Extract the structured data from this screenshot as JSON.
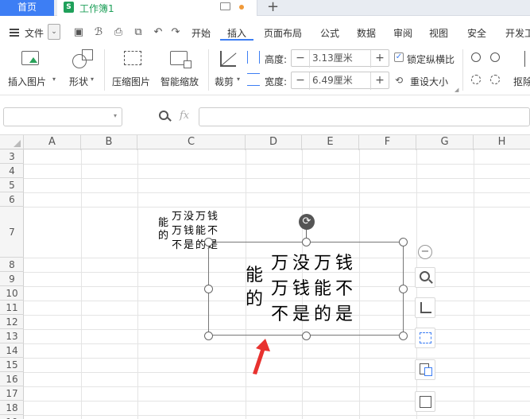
{
  "tabs": {
    "home": "首页",
    "workbook": "工作簿1",
    "workbook_icon": "S"
  },
  "menu": {
    "file": "文件",
    "items": [
      "开始",
      "插入",
      "页面布局",
      "公式",
      "数据",
      "审阅",
      "视图",
      "安全",
      "开发工"
    ],
    "active": "插入"
  },
  "ribbon": {
    "insert_picture": "插入图片",
    "shape": "形状",
    "compress_picture": "压缩图片",
    "smart_scale": "智能缩放",
    "crop": "裁剪",
    "height_label": "高度:",
    "height_value": "3.13厘米",
    "width_label": "宽度:",
    "width_value": "6.49厘米",
    "lock_ratio": "锁定纵横比",
    "reset_size": "重设大小",
    "remove_bg": "抠除"
  },
  "formula": {
    "fx": "fx"
  },
  "columns": [
    "A",
    "B",
    "C",
    "D",
    "E",
    "F",
    "G",
    "H"
  ],
  "rows": [
    "3",
    "4",
    "5",
    "6",
    "7",
    "8",
    "9",
    "10",
    "11",
    "12",
    "13",
    "14",
    "15",
    "16",
    "17",
    "18",
    "19"
  ],
  "small_text": {
    "left_col": "能\n的",
    "line1": "万没万钱",
    "line2": "万钱能不",
    "line3": "不是的是"
  },
  "big_text": {
    "left_col": "能\n的",
    "line1": "万没万钱",
    "line2": "万钱能不",
    "line3": "不是的是"
  },
  "colors": {
    "accent": "#3d7ef4",
    "brand_green": "#1fa05a",
    "arrow_red": "#e8322f"
  },
  "icons": [
    "hamburger-icon",
    "save-icon",
    "undo-icon",
    "redo-icon",
    "zoom-icon",
    "crop-icon",
    "rotate-icon",
    "arrow-icon"
  ]
}
